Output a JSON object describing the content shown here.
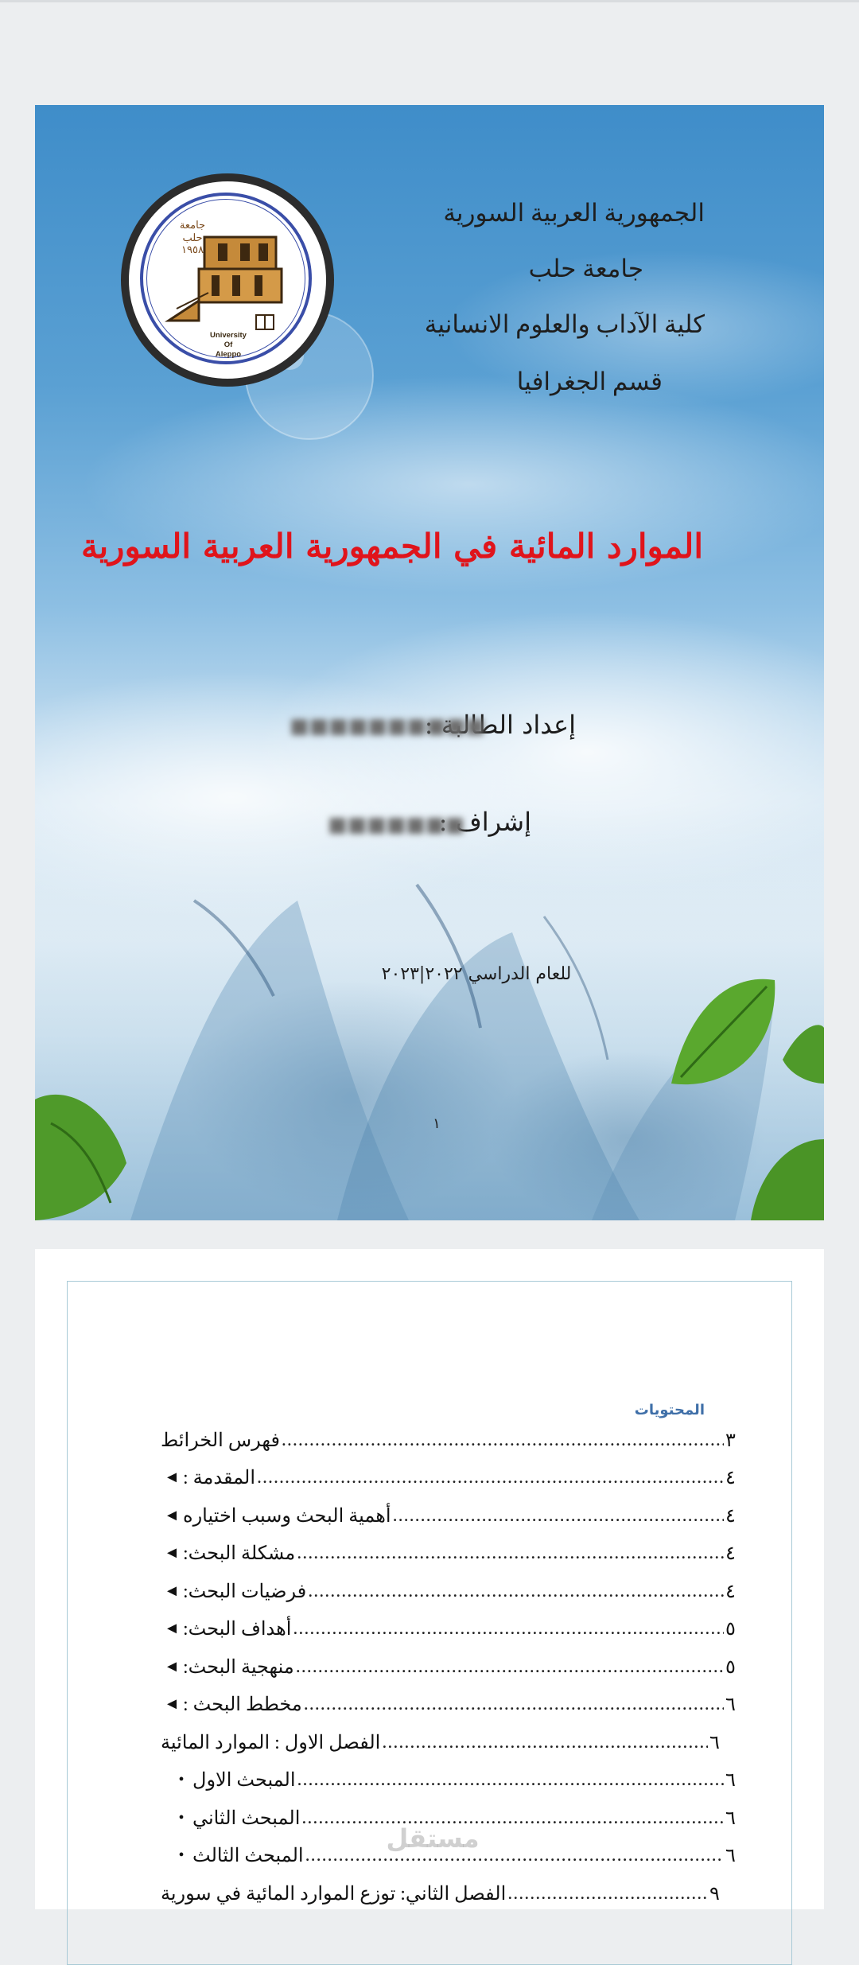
{
  "cover": {
    "logo": {
      "arabic_lines": [
        "جامعة",
        "حلب",
        "١٩٥٨"
      ],
      "english_lines": [
        "University",
        "Of",
        "Aleppo"
      ]
    },
    "institution_lines": [
      "الجمهورية العربية السورية",
      "جامعة حلب",
      "كلية الآداب والعلوم الانسانية",
      "قسم الجغرافيا"
    ],
    "title": "الموارد المائية في الجمهورية العربية السورية",
    "prepared_by_label": "إعداد الطالبة :",
    "supervisor_label": "إشراف :",
    "academic_year": "للعام الدراسي ٢٠٢٢|٢٠٢٣",
    "page_number": "١"
  },
  "toc": {
    "heading": "المحتويات",
    "rows": [
      {
        "marker": "",
        "label": "فهرس الخرائط",
        "page": "٣"
      },
      {
        "marker": "◄",
        "label": "المقدمة :",
        "page": "٤"
      },
      {
        "marker": "◄",
        "label": "أهمية البحث وسبب اختياره",
        "page": "٤"
      },
      {
        "marker": "◄",
        "label": "مشكلة البحث:",
        "page": "٤"
      },
      {
        "marker": "◄",
        "label": "فرضيات البحث:",
        "page": "٤"
      },
      {
        "marker": "◄",
        "label": "أهداف البحث:",
        "page": "٥"
      },
      {
        "marker": "◄",
        "label": "منهجية البحث:",
        "page": "٥"
      },
      {
        "marker": "◄",
        "label": "مخطط البحث :",
        "page": "٦"
      },
      {
        "marker": "",
        "label": "الفصل الاول : الموارد المائية",
        "page": "٦"
      },
      {
        "marker": "•",
        "label": "المبحث الاول",
        "page": "٦"
      },
      {
        "marker": "•",
        "label": "المبحث الثاني",
        "page": "٦"
      },
      {
        "marker": "•",
        "label": "المبحث الثالث",
        "page": "٦"
      },
      {
        "marker": "",
        "label": "الفصل الثاني: توزع الموارد المائية في سورية",
        "page": "٩"
      }
    ]
  },
  "watermark": "مستقل",
  "colors": {
    "title": "#e0141b",
    "toc_heading": "#3f6fa8",
    "frame": "#a8cad6"
  }
}
